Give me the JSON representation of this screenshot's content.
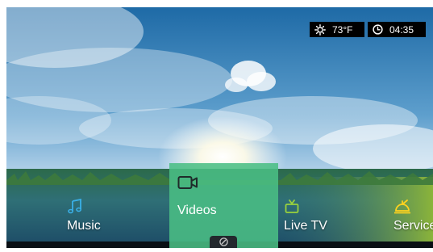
{
  "status": {
    "temperature": "73°F",
    "time": "04:35",
    "weather_icon": "sun-icon",
    "clock_icon": "clock-icon"
  },
  "menu": {
    "items": [
      {
        "label": "Music",
        "icon": "music-note-icon"
      },
      {
        "label": "Videos",
        "icon": "video-camera-icon",
        "selected": true
      },
      {
        "label": "Live TV",
        "icon": "tv-icon"
      },
      {
        "label": "Services",
        "icon": "bell-icon"
      }
    ]
  },
  "colors": {
    "accent_selected": "#4abe84",
    "icon_music": "#3ab0e8",
    "icon_tv": "#9ad23c",
    "icon_services": "#ffd21e"
  }
}
